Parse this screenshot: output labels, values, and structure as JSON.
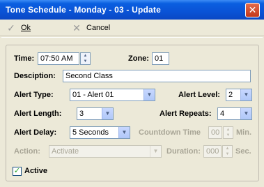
{
  "window": {
    "title": "Tone Schedule -  Monday - 03 - Update",
    "close_glyph": "✕"
  },
  "toolbar": {
    "ok_label": "Ok",
    "ok_icon": "checkmark-icon",
    "cancel_label": "Cancel",
    "cancel_icon": "x-icon"
  },
  "form": {
    "time_label": "Time:",
    "time_value": "07:50 AM",
    "zone_label": "Zone:",
    "zone_value": "01",
    "description_label": "Desciption:",
    "description_value": "Second Class",
    "alert_type_label": "Alert Type:",
    "alert_type_value": "01 - Alert 01",
    "alert_level_label": "Alert Level:",
    "alert_level_value": "2",
    "alert_length_label": "Alert Length:",
    "alert_length_value": "3",
    "alert_repeats_label": "Alert Repeats:",
    "alert_repeats_value": "4",
    "alert_delay_label": "Alert Delay:",
    "alert_delay_value": "5 Seconds",
    "countdown_label": "Countdown Time",
    "countdown_value": "00",
    "countdown_unit": "Min.",
    "action_label": "Action:",
    "action_value": "Activate",
    "duration_label": "Duration:",
    "duration_value": "000",
    "duration_unit": "Sec.",
    "active_label": "Active",
    "active_checked": true
  }
}
